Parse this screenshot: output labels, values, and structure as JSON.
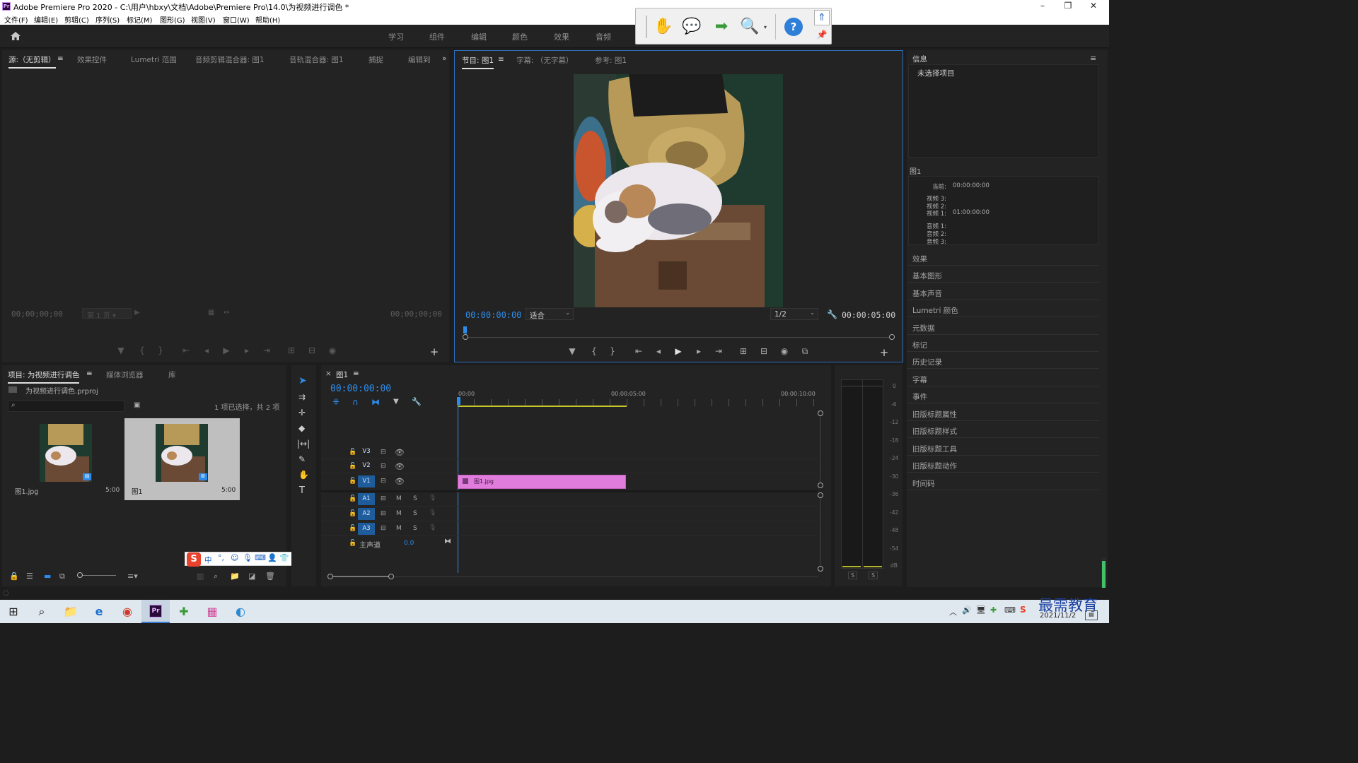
{
  "window": {
    "app_icon": "Pr",
    "title": "Adobe Premiere Pro 2020 - C:\\用户\\hbxy\\文档\\Adobe\\Premiere Pro\\14.0\\为视频进行调色 *",
    "minimize": "–",
    "maximize": "❐",
    "close": "✕"
  },
  "menu": [
    "文件(F)",
    "编辑(E)",
    "剪辑(C)",
    "序列(S)",
    "标记(M)",
    "图形(G)",
    "视图(V)",
    "窗口(W)",
    "帮助(H)"
  ],
  "workspaces": [
    "学习",
    "组件",
    "编辑",
    "颜色",
    "效果",
    "音频"
  ],
  "source_panel": {
    "tabs": [
      "源:（无剪辑）",
      "效果控件",
      "Lumetri 范围",
      "音频剪辑混合器: 图1",
      "音轨混合器: 图1",
      "捕捉",
      "编辑到"
    ],
    "overflow": "»",
    "menu": "≡",
    "timecode_left": "00;00;00;00",
    "page": "第 1 页",
    "timecode_right": "00;00;00;00"
  },
  "program_panel": {
    "tabs": [
      "节目: 图1",
      "字幕: （无字幕）",
      "参考: 图1"
    ],
    "menu": "≡",
    "timecode": "00:00:00:00",
    "zoom": "适合",
    "resolution": "1/2",
    "duration": "00:00:05:00"
  },
  "info_panel": {
    "title": "信息",
    "menu": "≡",
    "no_selection": "未选择项目",
    "sequence": "图1",
    "current_label": "当前:",
    "current_value": "00:00:00:00",
    "video_tracks": [
      {
        "label": "视频 3:",
        "value": ""
      },
      {
        "label": "视频 2:",
        "value": ""
      },
      {
        "label": "视频 1:",
        "value": "01:00:00:00"
      }
    ],
    "audio_tracks": [
      "音频 1:",
      "音频 2:",
      "音频 3:"
    ]
  },
  "right_panels": [
    "效果",
    "基本图形",
    "基本声音",
    "Lumetri 颜色",
    "元数据",
    "标记",
    "历史记录",
    "字幕",
    "事件",
    "旧版标题属性",
    "旧版标题样式",
    "旧版标题工具",
    "旧版标题动作",
    "时间码"
  ],
  "project_panel": {
    "tabs": [
      "项目: 为视频进行调色",
      "媒体浏览器",
      "库"
    ],
    "menu": "≡",
    "project_file": "为视频进行调色.prproj",
    "selection_status": "1 项已选择，共 2 项",
    "items": [
      {
        "name": "图1.jpg",
        "duration": "5:00"
      },
      {
        "name": "图1",
        "duration": "5:00"
      }
    ]
  },
  "ime_toolbar": {
    "logo": "S",
    "mode": "中"
  },
  "timeline": {
    "close": "×",
    "tab": "图1",
    "menu": "≡",
    "timecode": "00:00:00:00",
    "ruler": [
      "00:00",
      "00:00:05:00",
      "00:00:10:00"
    ],
    "video_tracks": [
      "V3",
      "V2",
      "V1"
    ],
    "audio_tracks": [
      "A1",
      "A2",
      "A3"
    ],
    "master": {
      "label": "主声道",
      "value": "0.0"
    },
    "clip": {
      "name": "图1.jpg",
      "color": "#e07ddc"
    },
    "mute": "M",
    "solo": "S"
  },
  "meter": {
    "scale": [
      "0",
      "-6",
      "-12",
      "-18",
      "-24",
      "-30",
      "-36",
      "-42",
      "-48",
      "-54",
      "dB"
    ],
    "solo": [
      "S",
      "S"
    ]
  },
  "taskbar": {
    "clock": "2021/11/2",
    "watermark": "最需教育"
  },
  "colors": {
    "accent": "#2d8ceb",
    "panel_bg": "#232323",
    "active_border": "#2d6fbd",
    "clip": "#e07ddc"
  }
}
